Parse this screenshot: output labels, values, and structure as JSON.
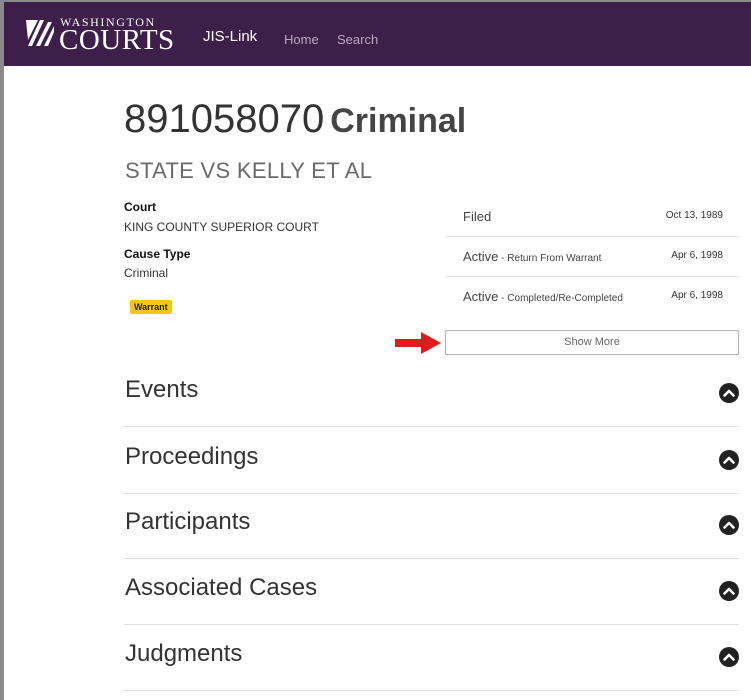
{
  "header": {
    "logo_top": "WASHINGTON",
    "logo_main": "COURTS",
    "app_name": "JIS-Link",
    "nav": [
      "Home",
      "Search"
    ]
  },
  "case": {
    "number": "891058070",
    "type": "Criminal",
    "title": "STATE VS KELLY ET AL",
    "court_label": "Court",
    "court_value": "KING COUNTY SUPERIOR COURT",
    "cause_type_label": "Cause Type",
    "cause_type_value": "Criminal",
    "badge": "Warrant"
  },
  "status_rows": [
    {
      "main": "Filed",
      "sub": "",
      "date": "Oct 13, 1989"
    },
    {
      "main": "Active",
      "sub": "Return From Warrant",
      "date": "Apr 6, 1998"
    },
    {
      "main": "Active",
      "sub": "Completed/Re-Completed",
      "date": "Apr 6, 1998"
    }
  ],
  "show_more_label": "Show More",
  "sections": [
    {
      "title": "Events"
    },
    {
      "title": "Proceedings"
    },
    {
      "title": "Participants"
    },
    {
      "title": "Associated Cases"
    },
    {
      "title": "Judgments"
    }
  ],
  "colors": {
    "header_bg": "#3e1f49",
    "badge": "#f5c518",
    "arrow": "#e3191b",
    "chevron": "#222222"
  },
  "icons": {
    "logo": "washington-courts-logo-icon",
    "arrow": "red-right-arrow-icon",
    "section_toggle": "chevron-up-circle-icon"
  }
}
